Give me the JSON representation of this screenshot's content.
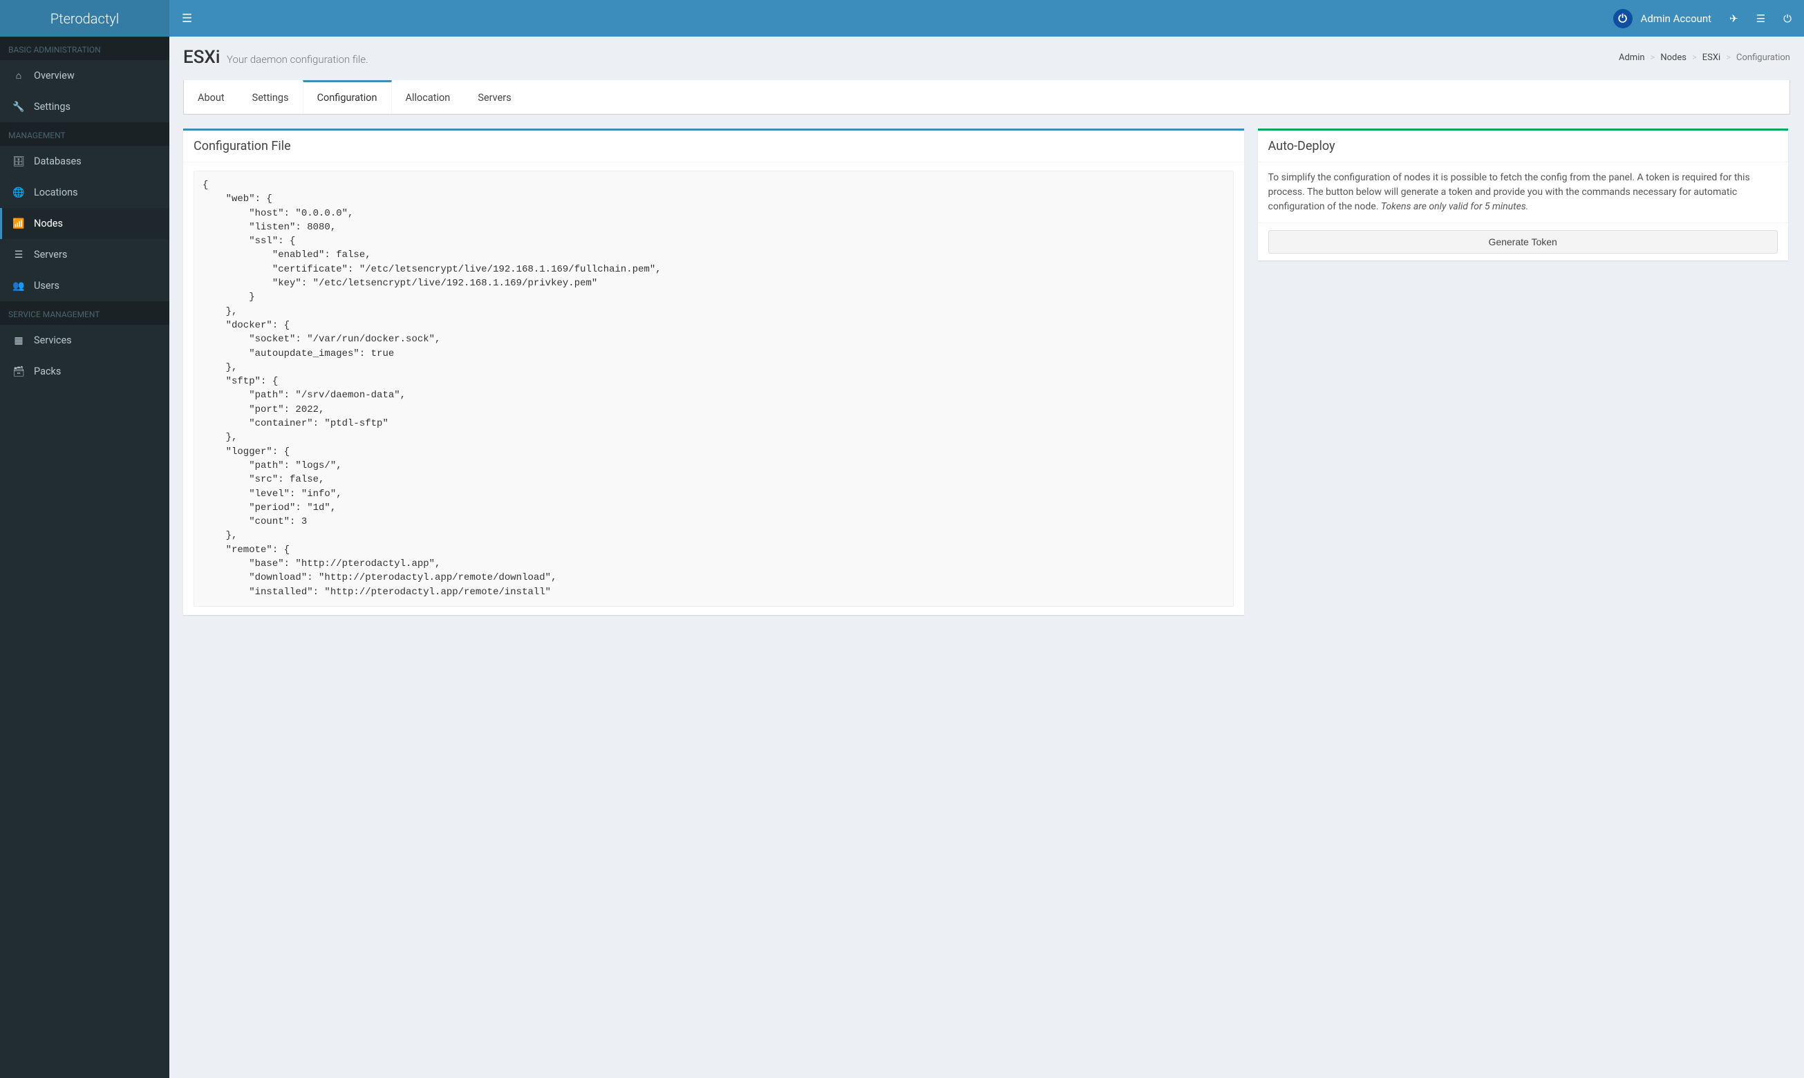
{
  "brand": "Pterodactyl",
  "navbar": {
    "user_name": "Admin Account"
  },
  "sidebar": {
    "sections": [
      {
        "header": "BASIC ADMINISTRATION",
        "items": [
          {
            "label": "Overview",
            "icon": "home-icon",
            "glyph": "⌂"
          },
          {
            "label": "Settings",
            "icon": "wrench-icon",
            "glyph": "🔧"
          }
        ]
      },
      {
        "header": "MANAGEMENT",
        "items": [
          {
            "label": "Databases",
            "icon": "database-icon",
            "glyph": "🗄"
          },
          {
            "label": "Locations",
            "icon": "globe-icon",
            "glyph": "🌐"
          },
          {
            "label": "Nodes",
            "icon": "sitemap-icon",
            "glyph": "📶",
            "active": true
          },
          {
            "label": "Servers",
            "icon": "server-icon",
            "glyph": "☰"
          },
          {
            "label": "Users",
            "icon": "users-icon",
            "glyph": "👥"
          }
        ]
      },
      {
        "header": "SERVICE MANAGEMENT",
        "items": [
          {
            "label": "Services",
            "icon": "th-large-icon",
            "glyph": "▦"
          },
          {
            "label": "Packs",
            "icon": "archive-icon",
            "glyph": "🗃"
          }
        ]
      }
    ]
  },
  "page": {
    "title": "ESXi",
    "subtitle": "Your daemon configuration file.",
    "breadcrumb": [
      "Admin",
      "Nodes",
      "ESXi",
      "Configuration"
    ]
  },
  "tabs": [
    "About",
    "Settings",
    "Configuration",
    "Allocation",
    "Servers"
  ],
  "active_tab": "Configuration",
  "config_box": {
    "title": "Configuration File",
    "content": "{\n    \"web\": {\n        \"host\": \"0.0.0.0\",\n        \"listen\": 8080,\n        \"ssl\": {\n            \"enabled\": false,\n            \"certificate\": \"/etc/letsencrypt/live/192.168.1.169/fullchain.pem\",\n            \"key\": \"/etc/letsencrypt/live/192.168.1.169/privkey.pem\"\n        }\n    },\n    \"docker\": {\n        \"socket\": \"/var/run/docker.sock\",\n        \"autoupdate_images\": true\n    },\n    \"sftp\": {\n        \"path\": \"/srv/daemon-data\",\n        \"port\": 2022,\n        \"container\": \"ptdl-sftp\"\n    },\n    \"logger\": {\n        \"path\": \"logs/\",\n        \"src\": false,\n        \"level\": \"info\",\n        \"period\": \"1d\",\n        \"count\": 3\n    },\n    \"remote\": {\n        \"base\": \"http://pterodactyl.app\",\n        \"download\": \"http://pterodactyl.app/remote/download\",\n        \"installed\": \"http://pterodactyl.app/remote/install\""
  },
  "deploy_box": {
    "title": "Auto-Deploy",
    "desc": "To simplify the configuration of nodes it is possible to fetch the config from the panel. A token is required for this process. The button below will generate a token and provide you with the commands necessary for automatic configuration of the node. ",
    "note": "Tokens are only valid for 5 minutes.",
    "button": "Generate Token"
  }
}
